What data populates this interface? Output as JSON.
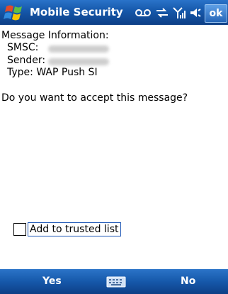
{
  "app": {
    "title": "Mobile Security",
    "ok_label": "ok"
  },
  "status_icons": [
    "voicemail-icon",
    "sync-icon",
    "signal-icon",
    "speaker-icon"
  ],
  "message": {
    "heading": "Message Information:",
    "smsc_label": "SMSC:",
    "sender_label": "Sender:",
    "type_label": "Type:",
    "type_value": "WAP Push SI",
    "question": "Do you want to accept this message?"
  },
  "trusted": {
    "label": "Add to trusted list",
    "checked": false
  },
  "softkeys": {
    "left": "Yes",
    "right": "No",
    "center_icon": "keyboard-icon"
  },
  "colors": {
    "bar": "#1557a9",
    "text": "#000000"
  }
}
